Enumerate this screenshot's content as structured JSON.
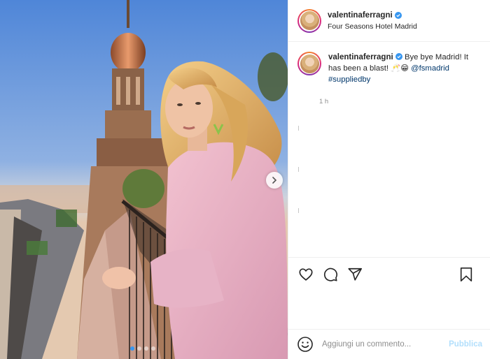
{
  "post": {
    "username": "valentinaferragni",
    "location": "Four Seasons Hotel Madrid",
    "verified_icon": "verified-badge-icon",
    "accent_color": "#3897f0"
  },
  "caption": {
    "username": "valentinaferragni",
    "text_before_mention": "Bye bye Madrid! It has been a blast! 🥂😁 ",
    "mention": "@fsmadrid",
    "hashtag": "#suppliedby",
    "time": "1 h"
  },
  "carousel": {
    "slide_count": 4,
    "active_slide": 1
  },
  "actions": {
    "like_icon": "heart-icon",
    "comment_icon": "comment-icon",
    "share_icon": "share-icon",
    "save_icon": "bookmark-icon"
  },
  "composer": {
    "emoji_icon": "smiley-icon",
    "placeholder": "Aggiungi un commento...",
    "publish_label": "Pubblica",
    "publish_color": "#b2dffc"
  }
}
